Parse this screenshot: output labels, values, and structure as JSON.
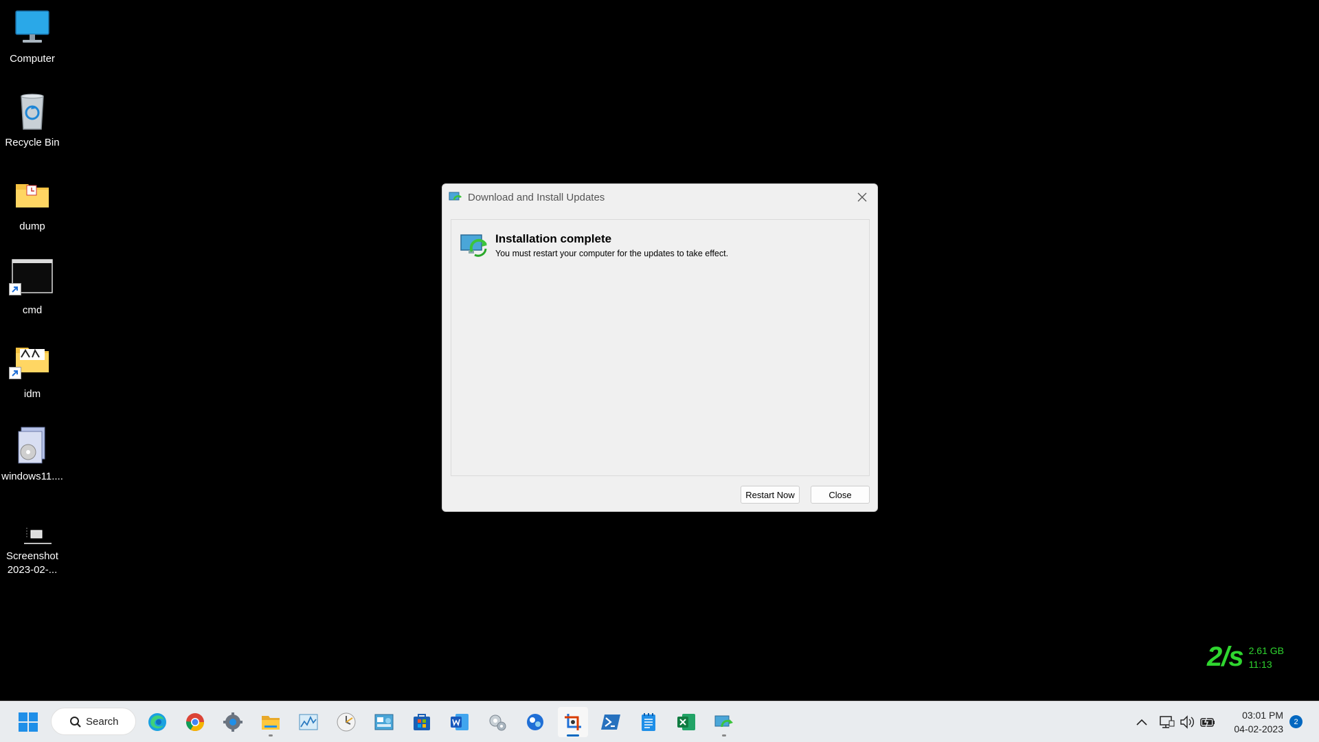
{
  "desktop": {
    "icons": [
      {
        "label": "Computer",
        "icon": "monitor-icon"
      },
      {
        "label": "Recycle Bin",
        "icon": "recycle-bin-icon"
      },
      {
        "label": "dump",
        "icon": "folder-icon"
      },
      {
        "label": "cmd",
        "icon": "cmd-icon"
      },
      {
        "label": "idm",
        "icon": "folder-icon"
      },
      {
        "label": "windows11....",
        "icon": "installer-icon"
      },
      {
        "label": "Screenshot 2023-02-...",
        "icon": "image-file-icon"
      }
    ]
  },
  "dialog": {
    "title": "Download and Install Updates",
    "heading": "Installation complete",
    "message": "You must restart your computer for the updates to take effect.",
    "restart_label": "Restart Now",
    "close_label": "Close"
  },
  "netmeter": {
    "speed": "2/s",
    "data_used": "2.61 GB",
    "time": "11:13"
  },
  "taskbar": {
    "search_label": "Search",
    "clock_time": "03:01 PM",
    "clock_date": "04-02-2023",
    "notification_count": "2"
  },
  "colors": {
    "accent": "#0067c0",
    "netmeter_green": "#2fd62f"
  }
}
